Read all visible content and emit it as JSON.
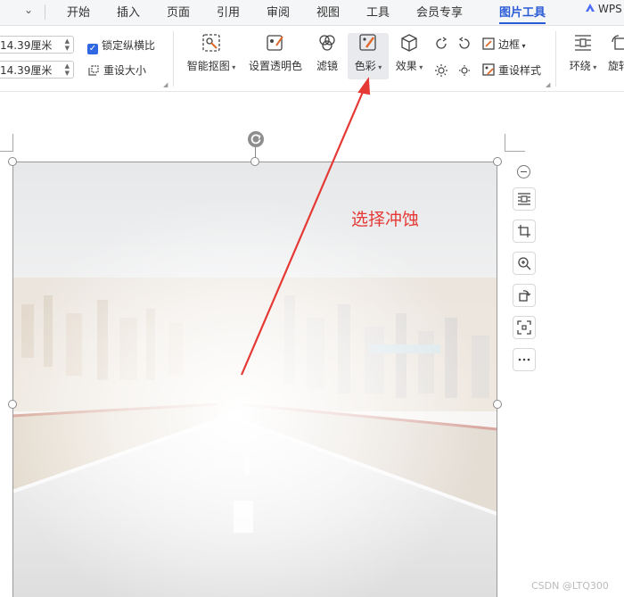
{
  "menubar": {
    "items": [
      "开始",
      "插入",
      "页面",
      "引用",
      "审阅",
      "视图",
      "工具",
      "会员专享",
      "图片工具"
    ],
    "active": "图片工具",
    "brand": "WPS"
  },
  "ribbon": {
    "height_value": "14.39厘米",
    "width_value": "14.39厘米",
    "lock_ratio": "锁定纵横比",
    "reset_size": "重设大小",
    "tools": {
      "smart_cutout": "智能抠图",
      "set_transparent": "设置透明色",
      "filter": "滤镜",
      "color": "色彩",
      "effects": "效果",
      "border": "边框",
      "reset_style": "重设样式",
      "wrap": "环绕",
      "rotate": "旋转"
    }
  },
  "annotation": {
    "text": "选择冲蚀",
    "color": "#e53935"
  },
  "watermark": "CSDN @LTQ300",
  "colors": {
    "accent": "#2a5bd7",
    "checkbox": "#3068e4",
    "arrow": "#e53935"
  }
}
